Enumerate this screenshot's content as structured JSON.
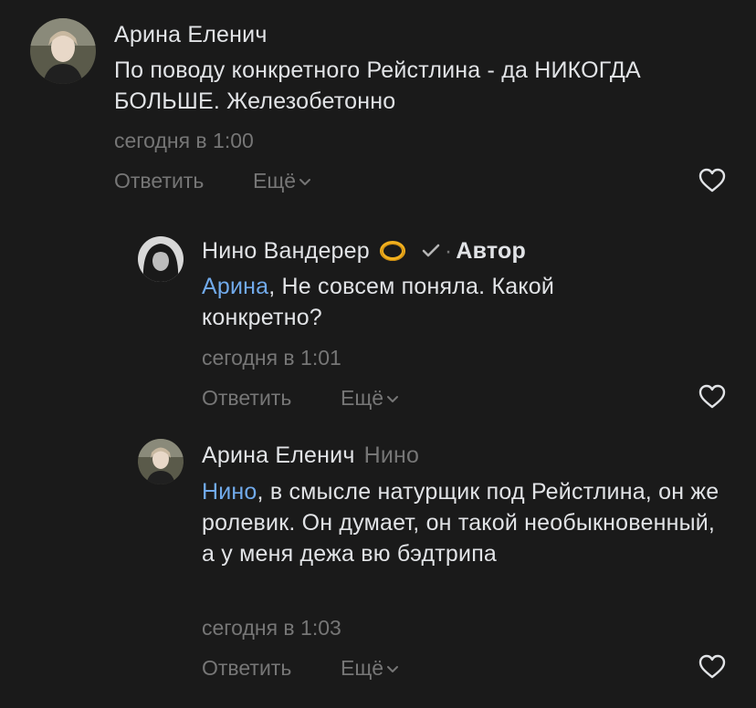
{
  "comments": [
    {
      "author": "Арина Еленич",
      "text": "По поводу конкретного Рейстлина - да НИКОГДА БОЛЬШЕ. Железобетонно",
      "time": "сегодня в 1:00",
      "reply_label": "Ответить",
      "more_label": "Ещё"
    },
    {
      "author": "Нино Вандерер",
      "author_badge": "Автор",
      "mention": "Арина",
      "text": ", Не совсем поняла. Какой конкретно?",
      "time": "сегодня в 1:01",
      "reply_label": "Ответить",
      "more_label": "Ещё"
    },
    {
      "author": "Арина Еленич",
      "reply_to": "Нино",
      "mention": "Нино",
      "text": ", в смысле натурщик под Рейстлина, он же ролевик. Он думает, он такой необыкновенный, а у меня дежа вю бэдтрипа",
      "time": "сегодня в 1:03",
      "reply_label": "Ответить",
      "more_label": "Ещё"
    }
  ],
  "colors": {
    "background": "#1a1a1a",
    "text": "#e1e3e6",
    "secondary": "#767676",
    "mention": "#71aaeb",
    "ring": "#f2b01e"
  },
  "icons": {
    "like": "heart-outline-icon",
    "more": "chevron-down-icon",
    "verified": "checkmark-icon",
    "ring": "ring-emoji-icon"
  }
}
